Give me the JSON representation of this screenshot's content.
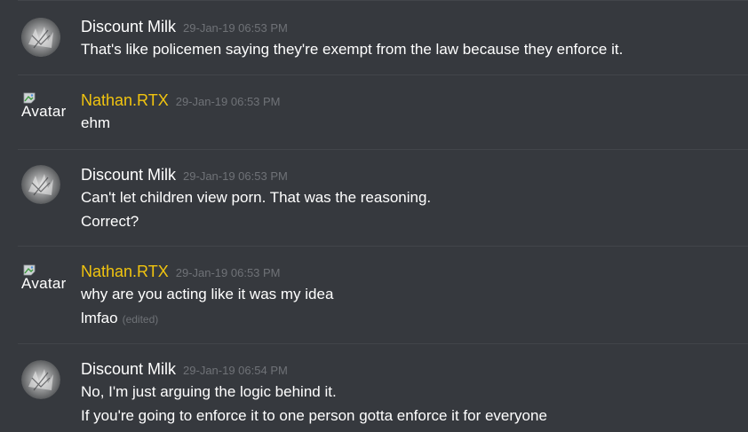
{
  "messages": [
    {
      "author": "Discount Milk",
      "timestamp": "29-Jan-19 06:53 PM",
      "avatar": "grey-sketch-avatar",
      "lines": [
        "That's like policemen saying they're exempt from the law because they enforce it."
      ]
    },
    {
      "author": "Nathan.RTX",
      "timestamp": "29-Jan-19 06:53 PM",
      "avatar": "broken-image-avatar",
      "avatar_alt": "Avatar",
      "lines": [
        "ehm"
      ]
    },
    {
      "author": "Discount Milk",
      "timestamp": "29-Jan-19 06:53 PM",
      "avatar": "grey-sketch-avatar",
      "lines": [
        "Can't let children view porn. That was the reasoning.",
        "Correct?"
      ]
    },
    {
      "author": "Nathan.RTX",
      "timestamp": "29-Jan-19 06:53 PM",
      "avatar": "broken-image-avatar",
      "avatar_alt": "Avatar",
      "lines": [
        "why are you acting like it was my idea",
        "lmfao"
      ],
      "edited_label": "(edited)"
    },
    {
      "author": "Discount Milk",
      "timestamp": "29-Jan-19 06:54 PM",
      "avatar": "grey-sketch-avatar",
      "lines": [
        "No, I'm just arguing the logic behind it.",
        "If you're going to enforce it to one person gotta enforce it for everyone"
      ]
    }
  ],
  "colors": {
    "background": "#36393e",
    "divider": "#42454a",
    "username_default": "#ffffff",
    "username_gold": "#f1c40f",
    "timestamp": "#6f7277"
  }
}
